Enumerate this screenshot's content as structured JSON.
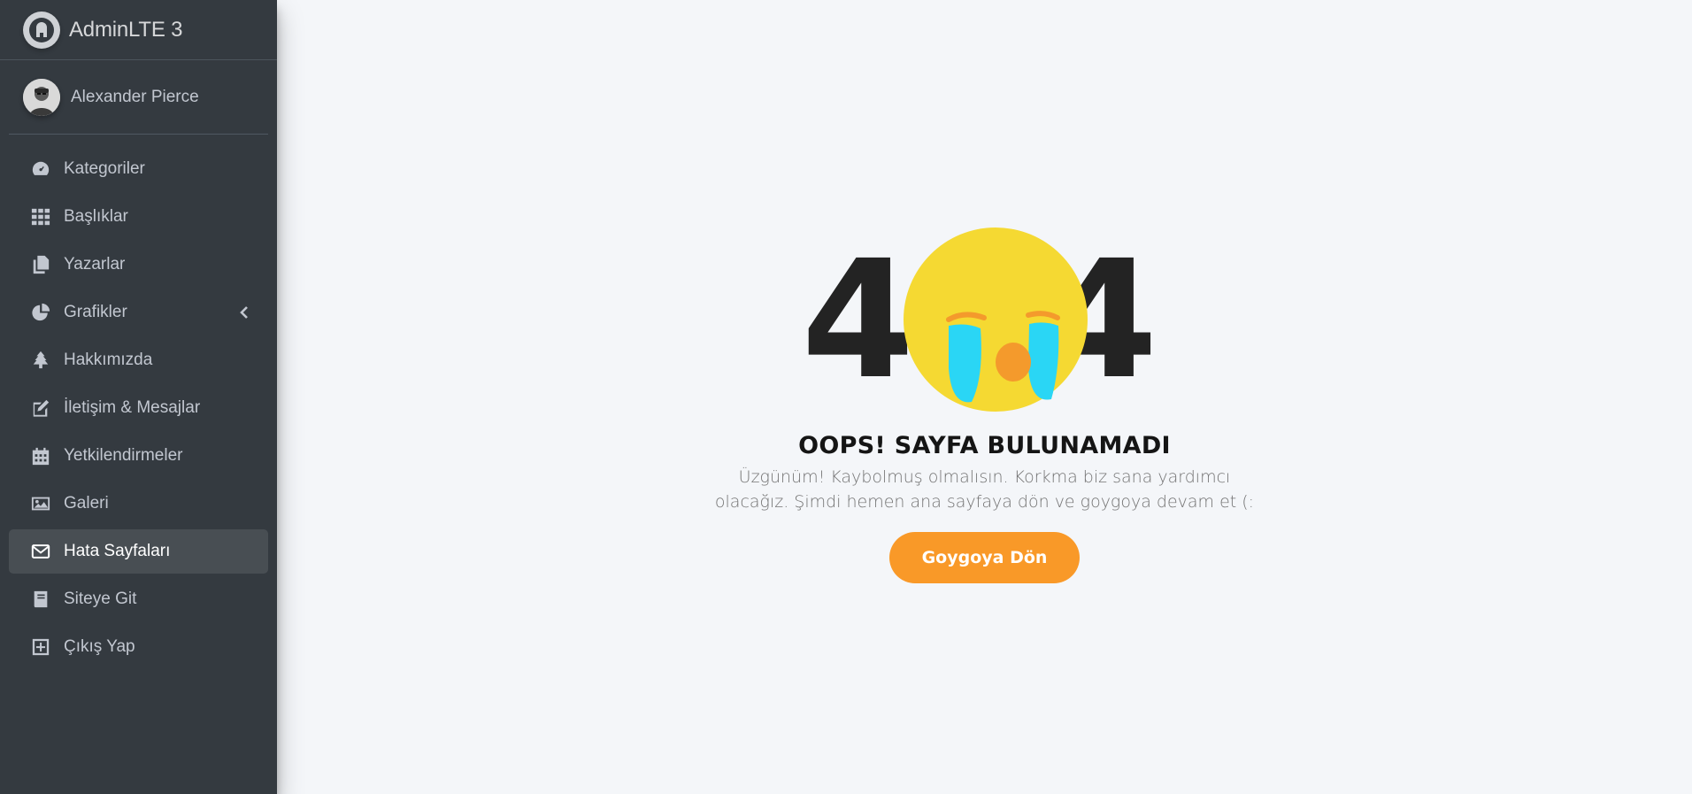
{
  "brand": {
    "name": "AdminLTE 3"
  },
  "user": {
    "name": "Alexander Pierce"
  },
  "sidebar": {
    "items": [
      {
        "label": "Kategoriler"
      },
      {
        "label": "Başlıklar"
      },
      {
        "label": "Yazarlar"
      },
      {
        "label": "Grafikler"
      },
      {
        "label": "Hakkımızda"
      },
      {
        "label": "İletişim & Mesajlar"
      },
      {
        "label": "Yetkilendirmeler"
      },
      {
        "label": "Galeri"
      },
      {
        "label": "Hata Sayfaları"
      },
      {
        "label": "Siteye Git"
      },
      {
        "label": "Çıkış Yap"
      }
    ],
    "active_item": "Hata Sayfaları"
  },
  "error": {
    "digit_left": "4",
    "digit_right": "4",
    "title": "OOPS! SAYFA BULUNAMADI",
    "line1": "Üzgünüm! Kaybolmuş olmalısın. Korkma biz sana yardımcı",
    "line2": "olacağız. Şimdi hemen ana sayfaya dön ve goygoya devam et (:",
    "button": "Goygoya Dön"
  },
  "colors": {
    "sidebar_bg": "#343a40",
    "content_bg": "#f4f6f9",
    "accent": "#f99928",
    "emoji_yellow": "#f5d932",
    "tear_blue": "#2ad6f5"
  }
}
